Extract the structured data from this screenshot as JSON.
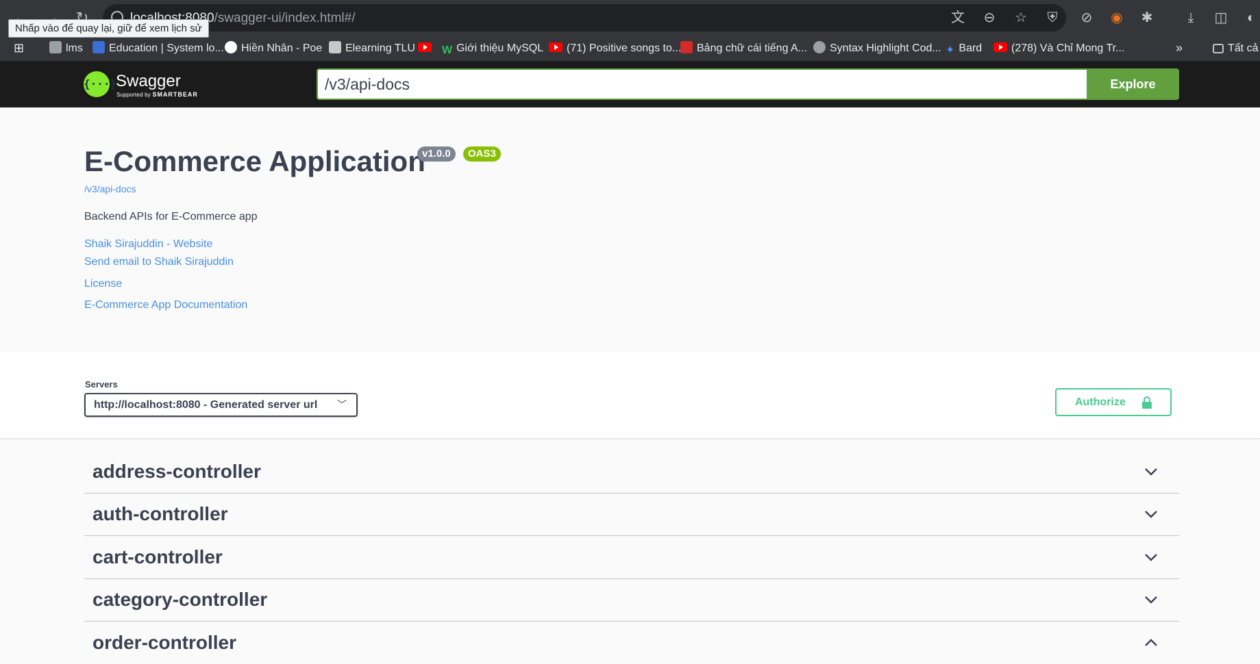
{
  "browser": {
    "url_host": "localhost:8080",
    "url_path": "/swagger-ui/index.html#/",
    "tooltip": "Nhấp vào để quay lại, giữ để xem lịch sử",
    "bookmarks": [
      {
        "label": "lms",
        "icon": "doc-icon"
      },
      {
        "label": "Education | System lo...",
        "icon": "edu-icon"
      },
      {
        "label": "Hiền Nhân - Poe",
        "icon": "poe-icon"
      },
      {
        "label": "Elearning TLU",
        "icon": "doc-icon"
      },
      {
        "label": "",
        "icon": "youtube-icon"
      },
      {
        "label": "Giới thiệu MySQL",
        "icon": "w-icon"
      },
      {
        "label": "(71) Positive songs to...",
        "icon": "youtube-icon"
      },
      {
        "label": "Bảng chữ cái tiếng A...",
        "icon": "red-icon"
      },
      {
        "label": "Syntax Highlight Cod...",
        "icon": "globe-icon"
      },
      {
        "label": "Bard",
        "icon": "sparkle-icon"
      },
      {
        "label": "(278) Và Chỉ Mong Tr...",
        "icon": "youtube-icon"
      }
    ],
    "all_bookmarks_label": "Tất cả"
  },
  "topbar": {
    "logo_title": "Swagger",
    "logo_sub_prefix": "Supported by",
    "logo_sub_brand": "SMARTBEAR",
    "explore_value": "/v3/api-docs",
    "explore_button": "Explore"
  },
  "info": {
    "title": "E-Commerce Application",
    "version": "v1.0.0",
    "oas": "OAS3",
    "api_url": "/v3/api-docs",
    "description": "Backend APIs for E-Commerce app",
    "contact_website": "Shaik Sirajuddin - Website",
    "contact_email": "Send email to Shaik Sirajuddin",
    "license": "License",
    "external_docs": "E-Commerce App Documentation"
  },
  "servers": {
    "label": "Servers",
    "selected": "http://localhost:8080 - Generated server url",
    "authorize": "Authorize"
  },
  "tags": [
    {
      "name": "address-controller",
      "expanded": false
    },
    {
      "name": "auth-controller",
      "expanded": false
    },
    {
      "name": "cart-controller",
      "expanded": false
    },
    {
      "name": "category-controller",
      "expanded": false
    },
    {
      "name": "order-controller",
      "expanded": true
    }
  ],
  "colors": {
    "swagger_green": "#85ea2d",
    "explore_green": "#62a03f",
    "authorize_green": "#49cc90",
    "link_blue": "#4990e2",
    "oas_badge": "#89bf04",
    "version_badge": "#7d8492"
  }
}
